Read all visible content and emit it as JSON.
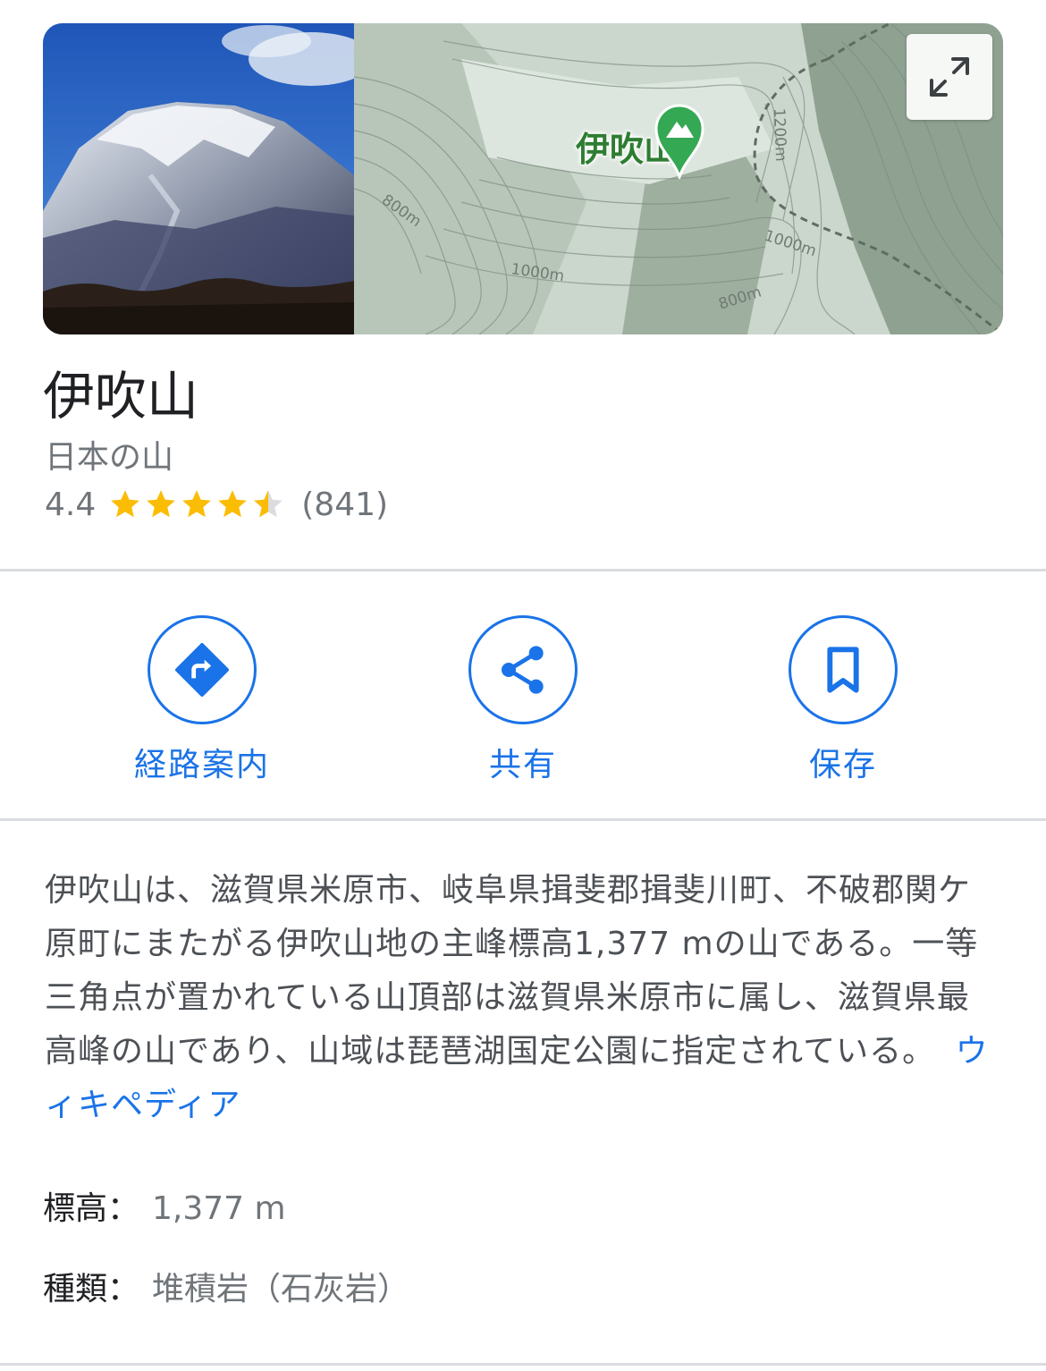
{
  "place": {
    "name": "伊吹山",
    "category": "日本の山",
    "rating": "4.4",
    "rating_value": 4.4,
    "review_count": "(841)"
  },
  "map": {
    "pin_label": "伊吹山",
    "contours": [
      "800m",
      "1000m",
      "1200m",
      "1000m",
      "800m"
    ],
    "expand_icon": "expand-icon"
  },
  "actions": [
    {
      "label": "経路案内",
      "icon": "directions-icon"
    },
    {
      "label": "共有",
      "icon": "share-icon"
    },
    {
      "label": "保存",
      "icon": "bookmark-icon"
    }
  ],
  "description": {
    "text": "伊吹山は、滋賀県米原市、岐阜県揖斐郡揖斐川町、不破郡関ケ原町にまたがる伊吹山地の主峰標高1,377 mの山である。一等三角点が置かれている山頂部は滋賀県米原市に属し、滋賀県最高峰の山であり、山域は琵琶湖国定公園に指定されている。",
    "source_link": "ウィキペディア"
  },
  "facts": [
    {
      "key": "標高：",
      "value": "1,377 m"
    },
    {
      "key": "種類：",
      "value": "堆積岩（石灰岩）"
    }
  ],
  "colors": {
    "accent": "#1a73e8",
    "star": "#fbbc04",
    "map_green": "#34a853"
  }
}
